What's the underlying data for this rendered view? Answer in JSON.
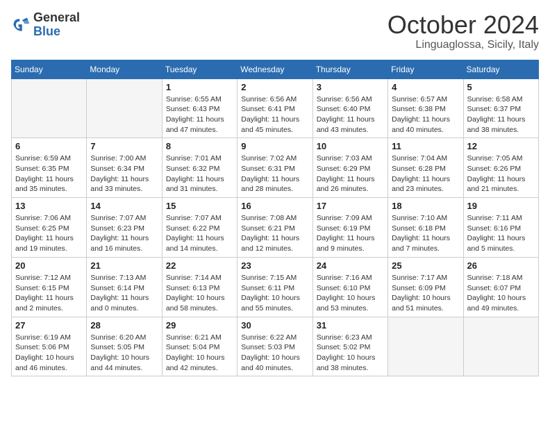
{
  "header": {
    "logo_general": "General",
    "logo_blue": "Blue",
    "month_title": "October 2024",
    "subtitle": "Linguaglossa, Sicily, Italy"
  },
  "days_of_week": [
    "Sunday",
    "Monday",
    "Tuesday",
    "Wednesday",
    "Thursday",
    "Friday",
    "Saturday"
  ],
  "weeks": [
    [
      {
        "day": "",
        "empty": true
      },
      {
        "day": "",
        "empty": true
      },
      {
        "day": "1",
        "sunrise": "6:55 AM",
        "sunset": "6:43 PM",
        "daylight": "11 hours and 47 minutes."
      },
      {
        "day": "2",
        "sunrise": "6:56 AM",
        "sunset": "6:41 PM",
        "daylight": "11 hours and 45 minutes."
      },
      {
        "day": "3",
        "sunrise": "6:56 AM",
        "sunset": "6:40 PM",
        "daylight": "11 hours and 43 minutes."
      },
      {
        "day": "4",
        "sunrise": "6:57 AM",
        "sunset": "6:38 PM",
        "daylight": "11 hours and 40 minutes."
      },
      {
        "day": "5",
        "sunrise": "6:58 AM",
        "sunset": "6:37 PM",
        "daylight": "11 hours and 38 minutes."
      }
    ],
    [
      {
        "day": "6",
        "sunrise": "6:59 AM",
        "sunset": "6:35 PM",
        "daylight": "11 hours and 35 minutes."
      },
      {
        "day": "7",
        "sunrise": "7:00 AM",
        "sunset": "6:34 PM",
        "daylight": "11 hours and 33 minutes."
      },
      {
        "day": "8",
        "sunrise": "7:01 AM",
        "sunset": "6:32 PM",
        "daylight": "11 hours and 31 minutes."
      },
      {
        "day": "9",
        "sunrise": "7:02 AM",
        "sunset": "6:31 PM",
        "daylight": "11 hours and 28 minutes."
      },
      {
        "day": "10",
        "sunrise": "7:03 AM",
        "sunset": "6:29 PM",
        "daylight": "11 hours and 26 minutes."
      },
      {
        "day": "11",
        "sunrise": "7:04 AM",
        "sunset": "6:28 PM",
        "daylight": "11 hours and 23 minutes."
      },
      {
        "day": "12",
        "sunrise": "7:05 AM",
        "sunset": "6:26 PM",
        "daylight": "11 hours and 21 minutes."
      }
    ],
    [
      {
        "day": "13",
        "sunrise": "7:06 AM",
        "sunset": "6:25 PM",
        "daylight": "11 hours and 19 minutes."
      },
      {
        "day": "14",
        "sunrise": "7:07 AM",
        "sunset": "6:23 PM",
        "daylight": "11 hours and 16 minutes."
      },
      {
        "day": "15",
        "sunrise": "7:07 AM",
        "sunset": "6:22 PM",
        "daylight": "11 hours and 14 minutes."
      },
      {
        "day": "16",
        "sunrise": "7:08 AM",
        "sunset": "6:21 PM",
        "daylight": "11 hours and 12 minutes."
      },
      {
        "day": "17",
        "sunrise": "7:09 AM",
        "sunset": "6:19 PM",
        "daylight": "11 hours and 9 minutes."
      },
      {
        "day": "18",
        "sunrise": "7:10 AM",
        "sunset": "6:18 PM",
        "daylight": "11 hours and 7 minutes."
      },
      {
        "day": "19",
        "sunrise": "7:11 AM",
        "sunset": "6:16 PM",
        "daylight": "11 hours and 5 minutes."
      }
    ],
    [
      {
        "day": "20",
        "sunrise": "7:12 AM",
        "sunset": "6:15 PM",
        "daylight": "11 hours and 2 minutes."
      },
      {
        "day": "21",
        "sunrise": "7:13 AM",
        "sunset": "6:14 PM",
        "daylight": "11 hours and 0 minutes."
      },
      {
        "day": "22",
        "sunrise": "7:14 AM",
        "sunset": "6:13 PM",
        "daylight": "10 hours and 58 minutes."
      },
      {
        "day": "23",
        "sunrise": "7:15 AM",
        "sunset": "6:11 PM",
        "daylight": "10 hours and 55 minutes."
      },
      {
        "day": "24",
        "sunrise": "7:16 AM",
        "sunset": "6:10 PM",
        "daylight": "10 hours and 53 minutes."
      },
      {
        "day": "25",
        "sunrise": "7:17 AM",
        "sunset": "6:09 PM",
        "daylight": "10 hours and 51 minutes."
      },
      {
        "day": "26",
        "sunrise": "7:18 AM",
        "sunset": "6:07 PM",
        "daylight": "10 hours and 49 minutes."
      }
    ],
    [
      {
        "day": "27",
        "sunrise": "6:19 AM",
        "sunset": "5:06 PM",
        "daylight": "10 hours and 46 minutes."
      },
      {
        "day": "28",
        "sunrise": "6:20 AM",
        "sunset": "5:05 PM",
        "daylight": "10 hours and 44 minutes."
      },
      {
        "day": "29",
        "sunrise": "6:21 AM",
        "sunset": "5:04 PM",
        "daylight": "10 hours and 42 minutes."
      },
      {
        "day": "30",
        "sunrise": "6:22 AM",
        "sunset": "5:03 PM",
        "daylight": "10 hours and 40 minutes."
      },
      {
        "day": "31",
        "sunrise": "6:23 AM",
        "sunset": "5:02 PM",
        "daylight": "10 hours and 38 minutes."
      },
      {
        "day": "",
        "empty": true
      },
      {
        "day": "",
        "empty": true
      }
    ]
  ]
}
